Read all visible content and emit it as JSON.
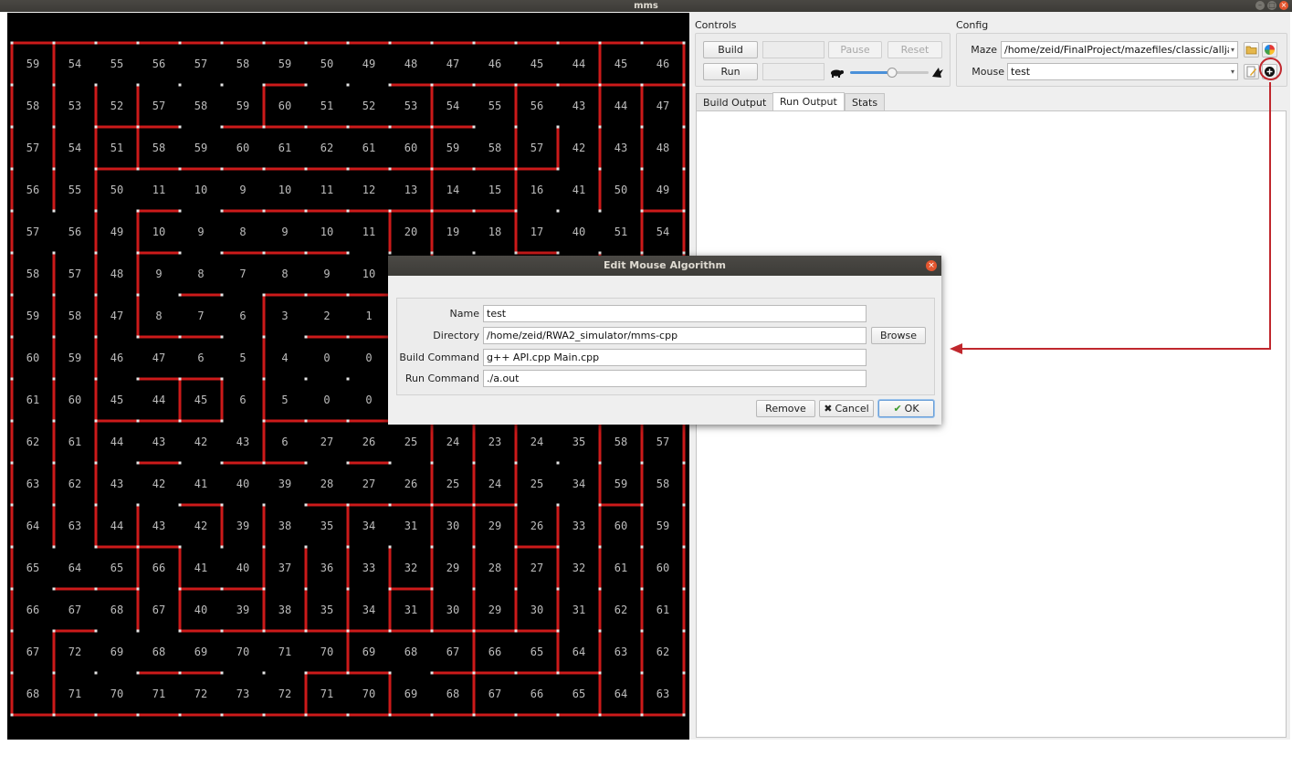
{
  "window": {
    "title": "mms"
  },
  "controls": {
    "label": "Controls",
    "build_label": "Build",
    "run_label": "Run",
    "pause_label": "Pause",
    "reset_label": "Reset"
  },
  "config": {
    "label": "Config",
    "maze_label": "Maze",
    "maze_path": "/home/zeid/FinalProject/mazefiles/classic/allja",
    "mouse_label": "Mouse",
    "mouse_value": "test"
  },
  "tabs": [
    "Build Output",
    "Run Output",
    "Stats"
  ],
  "active_tab": "Run Output",
  "dialog": {
    "title": "Edit Mouse Algorithm",
    "fields": {
      "name_label": "Name",
      "name_value": "test",
      "directory_label": "Directory",
      "directory_value": "/home/zeid/RWA2_simulator/mms-cpp",
      "build_label": "Build Command",
      "build_value": "g++ API.cpp Main.cpp",
      "run_label": "Run Command",
      "run_value": "./a.out"
    },
    "browse_label": "Browse",
    "remove_label": "Remove",
    "cancel_label": "Cancel",
    "ok_label": "OK"
  },
  "maze": {
    "rows": 16,
    "cols": 16,
    "wall_color": "#cc1a1a",
    "post_color": "#e6e6e6",
    "number_color": "#bcbcbc",
    "distances": [
      [
        59,
        54,
        55,
        56,
        57,
        58,
        59,
        50,
        49,
        48,
        47,
        46,
        45,
        44,
        45,
        46
      ],
      [
        58,
        53,
        52,
        57,
        58,
        59,
        60,
        51,
        52,
        53,
        54,
        55,
        56,
        43,
        44,
        47
      ],
      [
        57,
        54,
        51,
        58,
        59,
        60,
        61,
        62,
        61,
        60,
        59,
        58,
        57,
        42,
        43,
        48
      ],
      [
        56,
        55,
        50,
        11,
        10,
        9,
        10,
        11,
        12,
        13,
        14,
        15,
        16,
        41,
        50,
        49
      ],
      [
        57,
        56,
        49,
        10,
        9,
        8,
        9,
        10,
        11,
        20,
        19,
        18,
        17,
        40,
        51,
        54
      ],
      [
        58,
        57,
        48,
        9,
        8,
        7,
        8,
        9,
        10,
        null,
        null,
        null,
        null,
        null,
        null,
        null
      ],
      [
        59,
        58,
        47,
        8,
        7,
        6,
        3,
        2,
        1,
        null,
        null,
        null,
        null,
        null,
        null,
        null
      ],
      [
        60,
        59,
        46,
        47,
        6,
        5,
        4,
        0,
        0,
        null,
        null,
        null,
        null,
        null,
        null,
        null
      ],
      [
        61,
        60,
        45,
        44,
        45,
        6,
        5,
        0,
        0,
        null,
        null,
        null,
        null,
        null,
        null,
        null
      ],
      [
        62,
        61,
        44,
        43,
        42,
        43,
        6,
        27,
        26,
        25,
        24,
        23,
        24,
        35,
        58,
        57
      ],
      [
        63,
        62,
        43,
        42,
        41,
        40,
        39,
        28,
        27,
        26,
        25,
        24,
        25,
        34,
        59,
        58
      ],
      [
        64,
        63,
        44,
        43,
        42,
        39,
        38,
        35,
        34,
        31,
        30,
        29,
        26,
        33,
        60,
        59
      ],
      [
        65,
        64,
        65,
        66,
        41,
        40,
        37,
        36,
        33,
        32,
        29,
        28,
        27,
        32,
        61,
        60
      ],
      [
        66,
        67,
        68,
        67,
        40,
        39,
        38,
        35,
        34,
        31,
        30,
        29,
        30,
        31,
        62,
        61
      ],
      [
        67,
        72,
        69,
        68,
        69,
        70,
        71,
        70,
        69,
        68,
        67,
        66,
        65,
        64,
        63,
        62
      ],
      [
        68,
        71,
        70,
        71,
        72,
        73,
        72,
        71,
        70,
        69,
        68,
        67,
        66,
        65,
        64,
        63
      ]
    ],
    "hwalls": [
      [
        1,
        7
      ],
      [
        1,
        10
      ],
      [
        1,
        11
      ],
      [
        1,
        12
      ],
      [
        1,
        13
      ],
      [
        1,
        14
      ],
      [
        1,
        15
      ],
      [
        1,
        16
      ],
      [
        2,
        3
      ],
      [
        2,
        4
      ],
      [
        2,
        6
      ],
      [
        2,
        7
      ],
      [
        2,
        8
      ],
      [
        2,
        9
      ],
      [
        2,
        10
      ],
      [
        2,
        11
      ],
      [
        3,
        3
      ],
      [
        3,
        4
      ],
      [
        3,
        5
      ],
      [
        3,
        6
      ],
      [
        3,
        7
      ],
      [
        3,
        8
      ],
      [
        3,
        9
      ],
      [
        3,
        10
      ],
      [
        3,
        11
      ],
      [
        3,
        12
      ],
      [
        3,
        13
      ],
      [
        4,
        4
      ],
      [
        4,
        6
      ],
      [
        4,
        7
      ],
      [
        4,
        8
      ],
      [
        4,
        9
      ],
      [
        4,
        10
      ],
      [
        4,
        11
      ],
      [
        4,
        12
      ],
      [
        4,
        16
      ],
      [
        5,
        4
      ],
      [
        5,
        6
      ],
      [
        5,
        7
      ],
      [
        5,
        8
      ],
      [
        5,
        13
      ],
      [
        6,
        5
      ],
      [
        6,
        7
      ],
      [
        6,
        8
      ],
      [
        6,
        9
      ],
      [
        7,
        4
      ],
      [
        7,
        5
      ],
      [
        7,
        8
      ],
      [
        7,
        9
      ],
      [
        8,
        4
      ],
      [
        8,
        5
      ],
      [
        9,
        3
      ],
      [
        9,
        4
      ],
      [
        9,
        5
      ],
      [
        9,
        7
      ],
      [
        9,
        8
      ],
      [
        9,
        9
      ],
      [
        10,
        4
      ],
      [
        10,
        6
      ],
      [
        10,
        7
      ],
      [
        10,
        9
      ],
      [
        11,
        5
      ],
      [
        11,
        8
      ],
      [
        11,
        9
      ],
      [
        11,
        10
      ],
      [
        11,
        11
      ],
      [
        11,
        12
      ],
      [
        11,
        15
      ],
      [
        12,
        3
      ],
      [
        12,
        4
      ],
      [
        12,
        13
      ],
      [
        13,
        2
      ],
      [
        13,
        3
      ],
      [
        13,
        5
      ],
      [
        13,
        6
      ],
      [
        13,
        10
      ],
      [
        14,
        2
      ],
      [
        14,
        5
      ],
      [
        14,
        6
      ],
      [
        14,
        7
      ],
      [
        14,
        8
      ],
      [
        14,
        9
      ],
      [
        14,
        10
      ],
      [
        14,
        11
      ],
      [
        14,
        12
      ],
      [
        14,
        13
      ],
      [
        15,
        4
      ],
      [
        15,
        5
      ],
      [
        15,
        8
      ],
      [
        15,
        9
      ],
      [
        15,
        11
      ],
      [
        15,
        12
      ],
      [
        15,
        13
      ],
      [
        15,
        14
      ]
    ],
    "vwalls": [
      [
        0,
        1
      ],
      [
        1,
        1
      ],
      [
        2,
        1
      ],
      [
        3,
        1
      ],
      [
        5,
        1
      ],
      [
        6,
        1
      ],
      [
        7,
        1
      ],
      [
        8,
        1
      ],
      [
        9,
        1
      ],
      [
        10,
        1
      ],
      [
        11,
        1
      ],
      [
        14,
        1
      ],
      [
        15,
        1
      ],
      [
        1,
        2
      ],
      [
        2,
        2
      ],
      [
        3,
        2
      ],
      [
        4,
        2
      ],
      [
        5,
        2
      ],
      [
        6,
        2
      ],
      [
        7,
        2
      ],
      [
        8,
        2
      ],
      [
        9,
        2
      ],
      [
        10,
        2
      ],
      [
        11,
        2
      ],
      [
        1,
        3
      ],
      [
        2,
        3
      ],
      [
        4,
        3
      ],
      [
        5,
        3
      ],
      [
        6,
        3
      ],
      [
        11,
        3
      ],
      [
        12,
        3
      ],
      [
        13,
        3
      ],
      [
        12,
        4
      ],
      [
        13,
        4
      ],
      [
        8,
        4
      ],
      [
        8,
        5
      ],
      [
        11,
        5
      ],
      [
        1,
        6
      ],
      [
        6,
        6
      ],
      [
        7,
        6
      ],
      [
        8,
        6
      ],
      [
        9,
        6
      ],
      [
        11,
        6
      ],
      [
        12,
        6
      ],
      [
        13,
        6
      ],
      [
        12,
        7
      ],
      [
        13,
        7
      ],
      [
        15,
        7
      ],
      [
        11,
        8
      ],
      [
        12,
        8
      ],
      [
        13,
        8
      ],
      [
        14,
        8
      ],
      [
        4,
        9
      ],
      [
        12,
        9
      ],
      [
        13,
        9
      ],
      [
        15,
        9
      ],
      [
        1,
        10
      ],
      [
        2,
        10
      ],
      [
        3,
        10
      ],
      [
        4,
        10
      ],
      [
        5,
        10
      ],
      [
        6,
        10
      ],
      [
        7,
        10
      ],
      [
        9,
        10
      ],
      [
        10,
        10
      ],
      [
        11,
        10
      ],
      [
        12,
        10
      ],
      [
        13,
        10
      ],
      [
        9,
        11
      ],
      [
        10,
        11
      ],
      [
        11,
        11
      ],
      [
        12,
        11
      ],
      [
        13,
        11
      ],
      [
        14,
        11
      ],
      [
        15,
        11
      ],
      [
        1,
        12
      ],
      [
        2,
        12
      ],
      [
        3,
        12
      ],
      [
        4,
        12
      ],
      [
        9,
        12
      ],
      [
        10,
        12
      ],
      [
        11,
        12
      ],
      [
        12,
        12
      ],
      [
        13,
        12
      ],
      [
        2,
        13
      ],
      [
        11,
        13
      ],
      [
        12,
        13
      ],
      [
        13,
        13
      ],
      [
        14,
        13
      ],
      [
        1,
        14
      ],
      [
        10,
        14
      ],
      [
        11,
        14
      ],
      [
        13,
        14
      ],
      [
        14,
        14
      ],
      [
        1,
        15
      ],
      [
        3,
        15
      ],
      [
        14,
        15
      ],
      [
        15,
        15
      ],
      [
        0,
        14
      ],
      [
        1,
        14
      ],
      [
        2,
        14
      ],
      [
        3,
        14
      ],
      [
        5,
        14
      ],
      [
        6,
        14
      ],
      [
        7,
        14
      ],
      [
        9,
        14
      ],
      [
        10,
        14
      ],
      [
        11,
        14
      ],
      [
        12,
        14
      ],
      [
        13,
        14
      ],
      [
        14,
        14
      ],
      [
        15,
        14
      ],
      [
        2,
        15
      ],
      [
        3,
        15
      ],
      [
        4,
        15
      ],
      [
        5,
        15
      ],
      [
        6,
        15
      ],
      [
        9,
        15
      ],
      [
        10,
        15
      ],
      [
        11,
        15
      ],
      [
        12,
        15
      ],
      [
        13,
        15
      ],
      [
        14,
        15
      ]
    ]
  }
}
